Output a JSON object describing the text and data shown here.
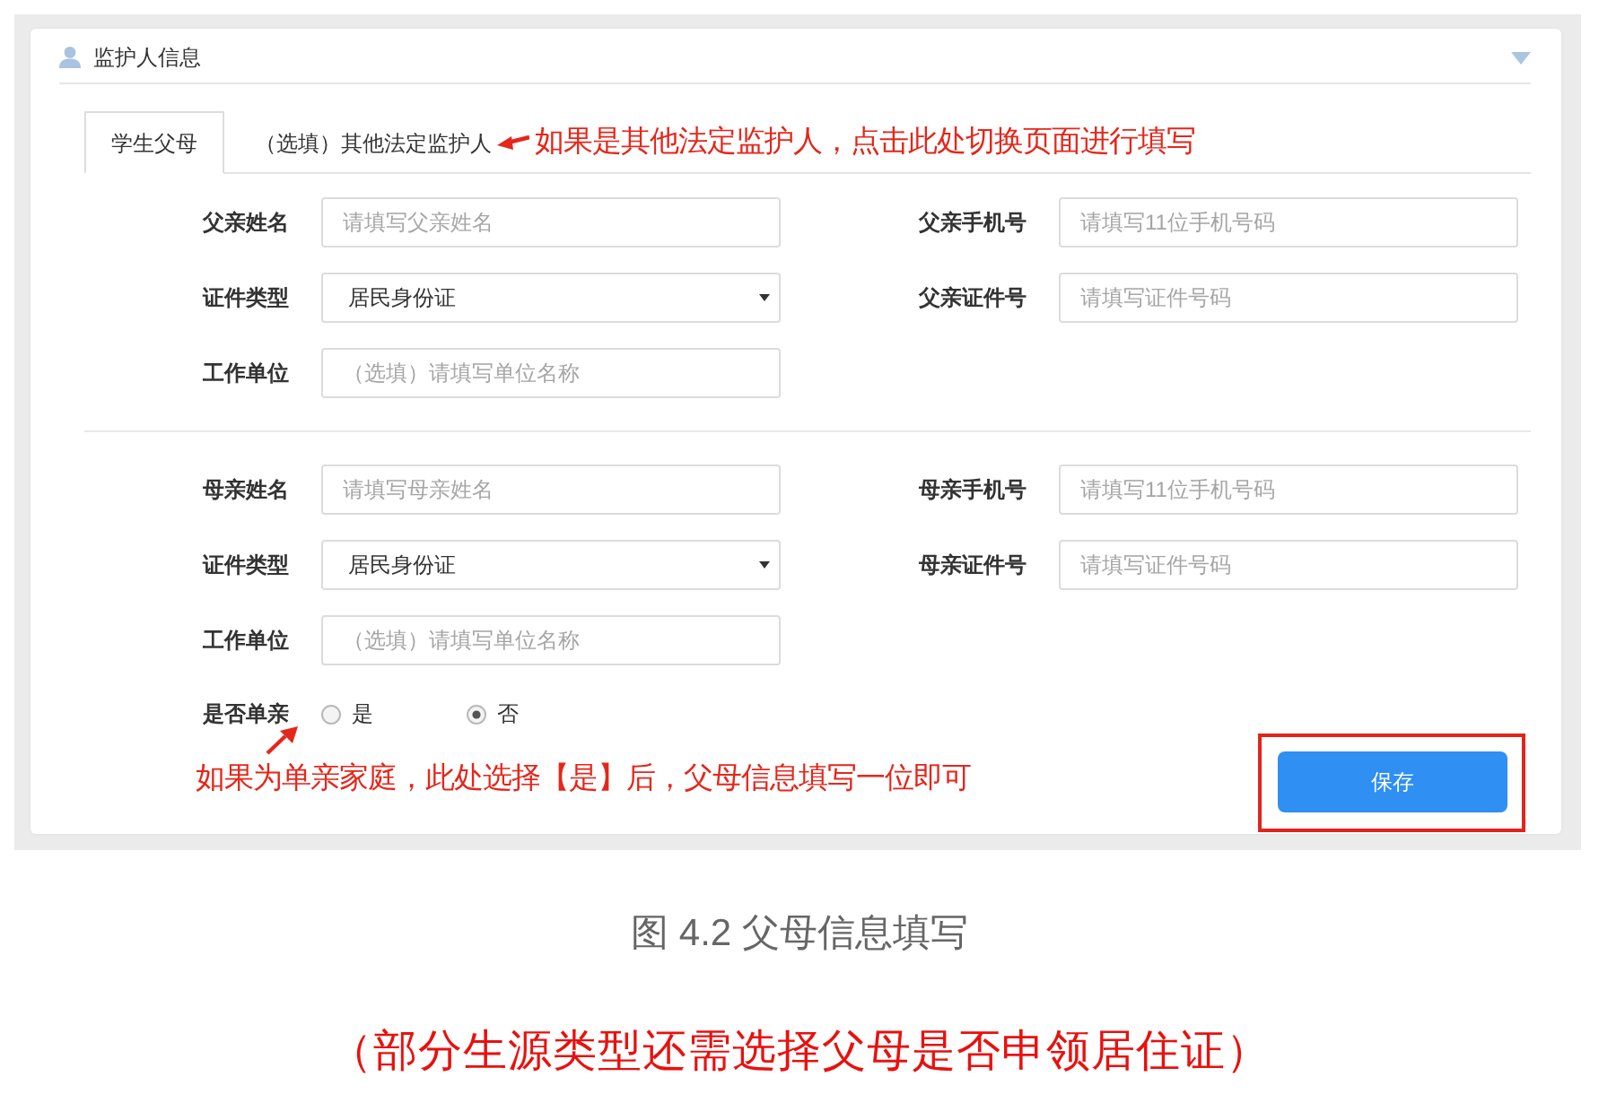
{
  "panel": {
    "title": "监护人信息"
  },
  "tabs": [
    {
      "label": "学生父母",
      "selected": true
    },
    {
      "label": "（选填）其他法定监护人",
      "selected": false
    }
  ],
  "tab_annotation": "如果是其他法定监护人，点击此处切换页面进行填写",
  "sections": [
    {
      "fields": [
        {
          "kind": "text",
          "label": "父亲姓名",
          "placeholder": "请填写父亲姓名"
        },
        {
          "kind": "text",
          "label": "父亲手机号",
          "placeholder": "请填写11位手机号码"
        },
        {
          "kind": "select",
          "label": "证件类型",
          "value": "居民身份证"
        },
        {
          "kind": "text",
          "label": "父亲证件号",
          "placeholder": "请填写证件号码"
        },
        {
          "kind": "text",
          "label": "工作单位",
          "placeholder": "（选填）请填写单位名称"
        }
      ]
    },
    {
      "fields": [
        {
          "kind": "text",
          "label": "母亲姓名",
          "placeholder": "请填写母亲姓名"
        },
        {
          "kind": "text",
          "label": "母亲手机号",
          "placeholder": "请填写11位手机号码"
        },
        {
          "kind": "select",
          "label": "证件类型",
          "value": "居民身份证"
        },
        {
          "kind": "text",
          "label": "母亲证件号",
          "placeholder": "请填写证件号码"
        },
        {
          "kind": "text",
          "label": "工作单位",
          "placeholder": "（选填）请填写单位名称"
        }
      ]
    }
  ],
  "single_parent": {
    "label": "是否单亲",
    "options": [
      {
        "label": "是",
        "selected": false
      },
      {
        "label": "否",
        "selected": true
      }
    ],
    "annotation": "如果为单亲家庭，此处选择【是】后，父母信息填写一位即可"
  },
  "save_button": {
    "label": "保存"
  },
  "caption": "图 4.2 父母信息填写",
  "note": "（部分生源类型还需选择父母是否申领居住证）"
}
